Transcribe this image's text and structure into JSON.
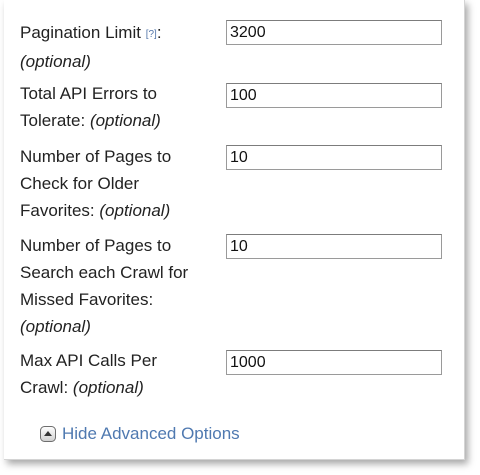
{
  "colors": {
    "link": "#4f79b0",
    "text": "#222222",
    "help": "#5577aa"
  },
  "help_marker": "[?]",
  "optional_text": "(optional)",
  "fields": {
    "pagination_limit": {
      "label": "Pagination Limit",
      "suffix": ":",
      "value": "3200"
    },
    "total_api_errors": {
      "label_line1": "Total API Errors to",
      "label_line2": "Tolerate:",
      "value": "100"
    },
    "older_favorites_pages": {
      "label_line1": "Number of Pages to",
      "label_line2": "Check for Older",
      "label_line3": "Favorites:",
      "value": "10"
    },
    "missed_favorites_pages": {
      "label_line1": "Number of Pages to",
      "label_line2": "Search each Crawl for",
      "label_line3": "Missed Favorites:",
      "value": "10"
    },
    "max_api_calls": {
      "label_line1": "Max API Calls Per",
      "label_line2": "Crawl:",
      "value": "1000"
    }
  },
  "advanced_toggle": {
    "label": "Hide Advanced Options",
    "icon": "collapse-up-icon"
  }
}
